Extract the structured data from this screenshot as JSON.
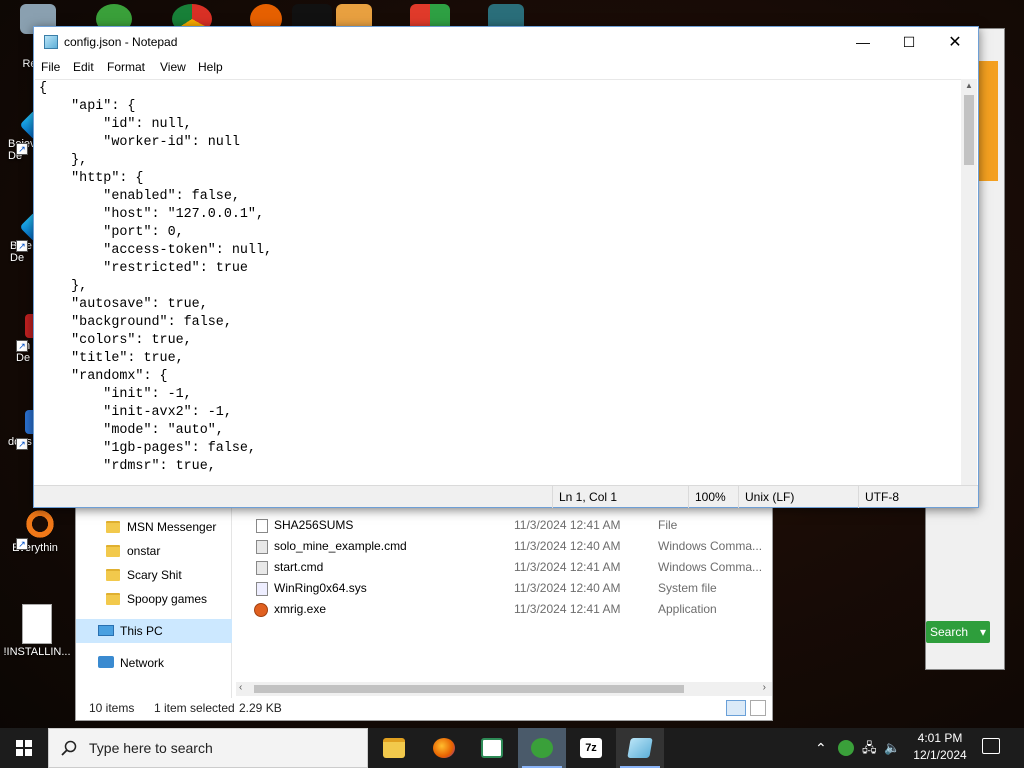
{
  "desktop": {
    "icons": [
      {
        "label": "Recy"
      },
      {
        "label": "Bejev\nDe"
      },
      {
        "label": "Beje\nDe"
      },
      {
        "label": "Ch\nDe"
      },
      {
        "label": "does"
      },
      {
        "label": "Everythin"
      },
      {
        "label": "!INSTALLIN..."
      }
    ]
  },
  "notepad": {
    "title": "config.json - Notepad",
    "menu": [
      "File",
      "Edit",
      "Format",
      "View",
      "Help"
    ],
    "content": "{\n    \"api\": {\n        \"id\": null,\n        \"worker-id\": null\n    },\n    \"http\": {\n        \"enabled\": false,\n        \"host\": \"127.0.0.1\",\n        \"port\": 0,\n        \"access-token\": null,\n        \"restricted\": true\n    },\n    \"autosave\": true,\n    \"background\": false,\n    \"colors\": true,\n    \"title\": true,\n    \"randomx\": {\n        \"init\": -1,\n        \"init-avx2\": -1,\n        \"mode\": \"auto\",\n        \"1gb-pages\": false,\n        \"rdmsr\": true,",
    "status": {
      "position": "Ln 1, Col 1",
      "zoom": "100%",
      "line_ending": "Unix (LF)",
      "encoding": "UTF-8"
    }
  },
  "explorer": {
    "nav": [
      "MSN Messenger",
      "onstar",
      "Scary Shit",
      "Spoopy games",
      "This PC",
      "Network"
    ],
    "files": [
      {
        "name": "SHA256SUMS",
        "date": "11/3/2024 12:41 AM",
        "type": "File"
      },
      {
        "name": "solo_mine_example.cmd",
        "date": "11/3/2024 12:40 AM",
        "type": "Windows Comma..."
      },
      {
        "name": "start.cmd",
        "date": "11/3/2024 12:41 AM",
        "type": "Windows Comma..."
      },
      {
        "name": "WinRing0x64.sys",
        "date": "11/3/2024 12:40 AM",
        "type": "System file"
      },
      {
        "name": "xmrig.exe",
        "date": "11/3/2024 12:41 AM",
        "type": "Application"
      }
    ],
    "status": {
      "count": "10 items",
      "selected": "1 item selected",
      "size": "2.29 KB"
    }
  },
  "rightwin": {
    "search_label": "Search"
  },
  "taskbar": {
    "search_placeholder": "Type here to search",
    "time": "4:01 PM",
    "date": "12/1/2024"
  }
}
